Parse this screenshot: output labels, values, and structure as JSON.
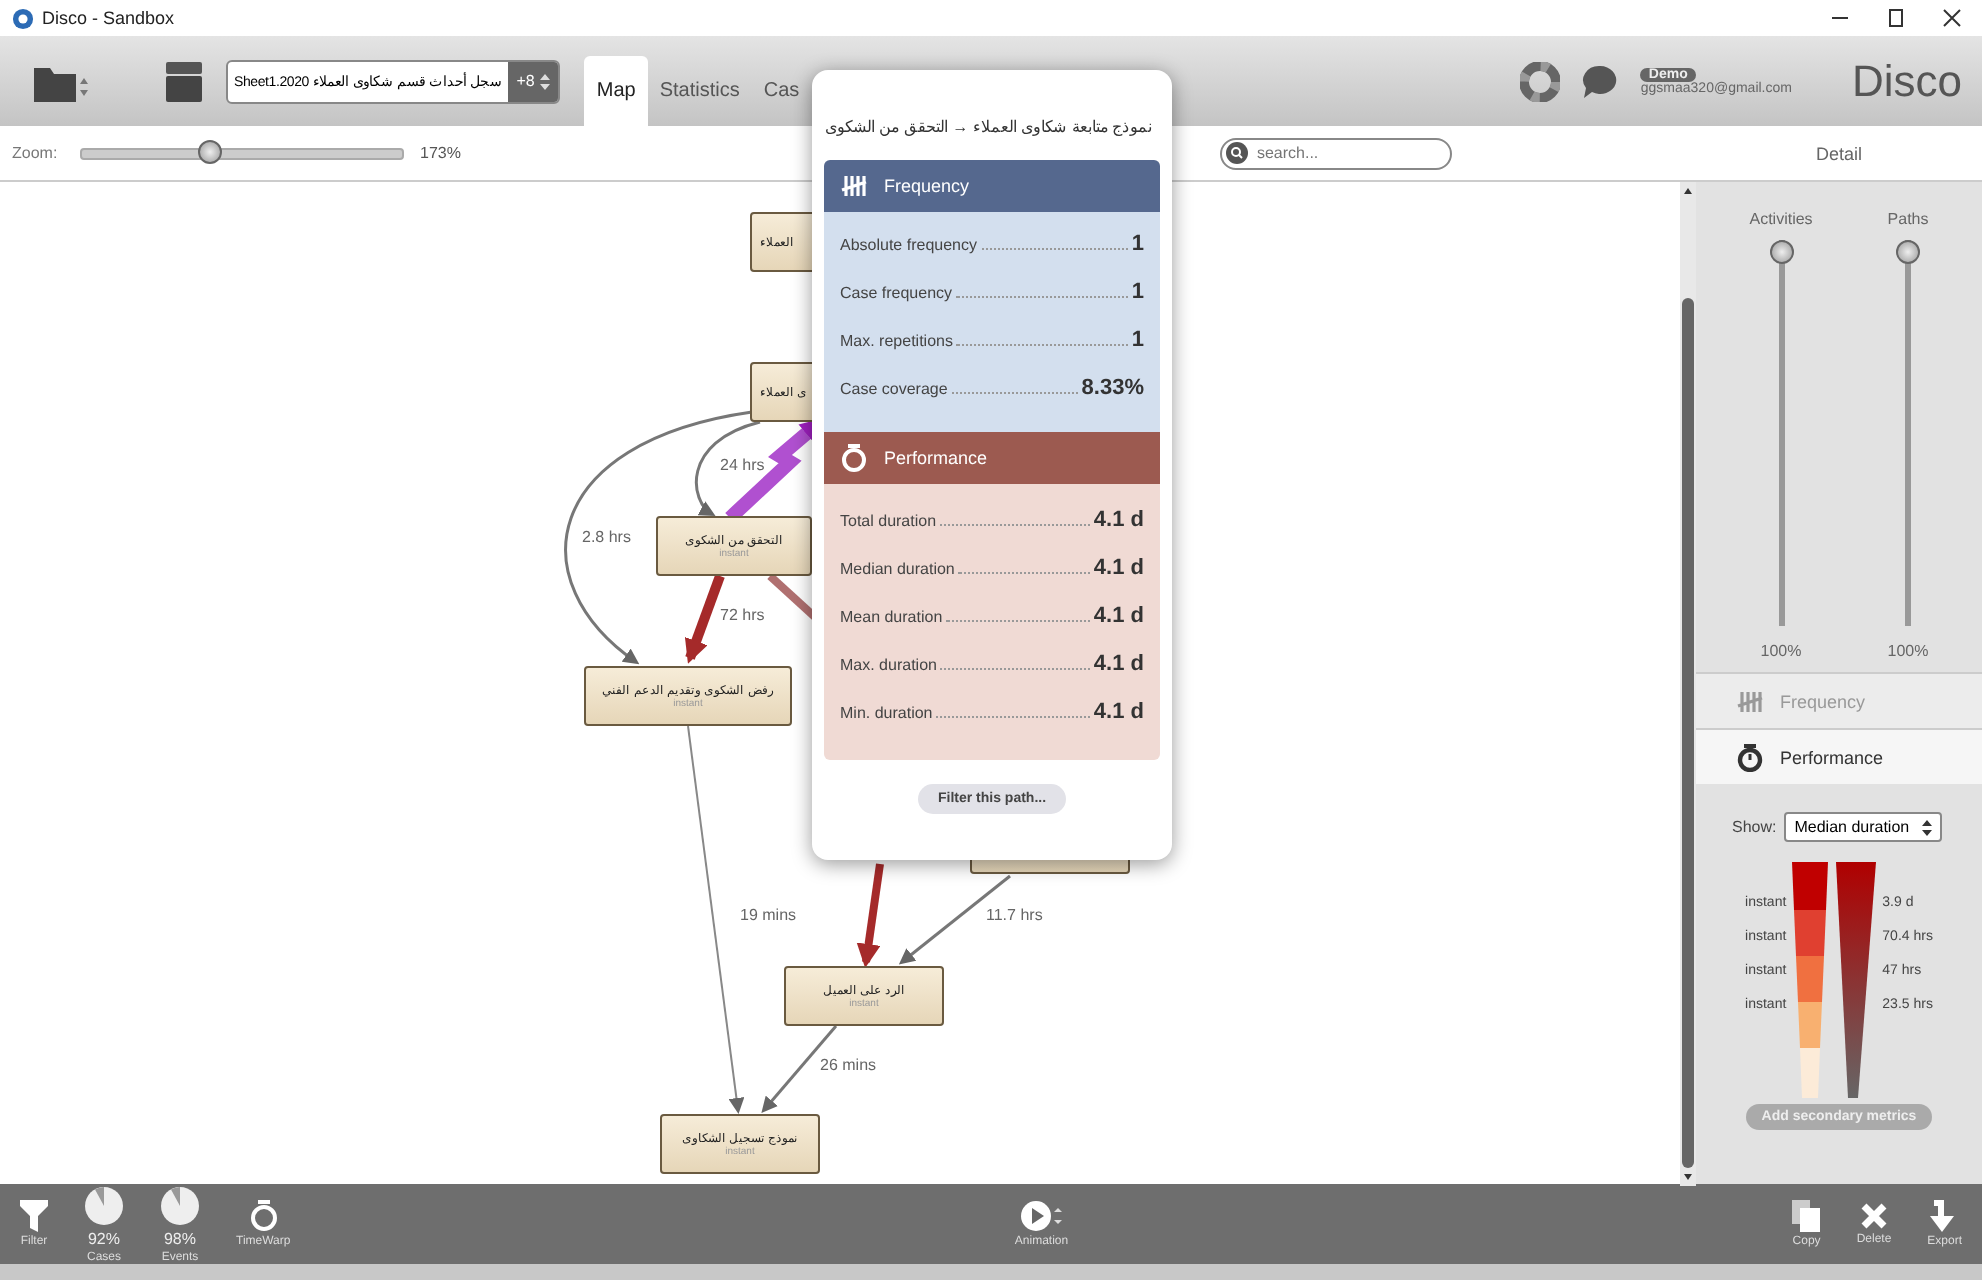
{
  "window": {
    "title": "Disco - Sandbox"
  },
  "toolbar": {
    "dataset": {
      "name": "سجل أحداث قسم شكاوى العملاء Sheet1.2020",
      "count": "+8"
    },
    "tabs": [
      {
        "label": "Map",
        "selected": true
      },
      {
        "label": "Statistics",
        "selected": false
      },
      {
        "label": "Cas",
        "selected": false
      }
    ],
    "user": {
      "badge": "Demo",
      "email": "ggsmaa320@gmail.com"
    },
    "logo": "Disco"
  },
  "zoom": {
    "label": "Zoom:",
    "level": 0.4,
    "reading": "173%"
  },
  "search": {
    "placeholder": "search..."
  },
  "map": {
    "nodes": [
      {
        "label": "العملاء"
      },
      {
        "label": "ى العملاء"
      },
      {
        "label": "التحقق من الشكوى",
        "sublabel": "instant"
      },
      {
        "label": "رفض الشكوى وتقديم الدعم الفني",
        "sublabel": "instant"
      },
      {
        "label": "الرد على العميل",
        "sublabel": "instant"
      },
      {
        "label": "نموذج تسجيل الشكاوى",
        "sublabel": "instant"
      }
    ],
    "edge_labels": [
      "24 hrs",
      "2.8 hrs",
      "72 hrs",
      "19 mins",
      "11.7 hrs",
      "26 mins"
    ]
  },
  "popup": {
    "title": "نموذج متابعة شكاوى العملاء → التحقق من الشكوى",
    "sections": [
      {
        "kind": "frequency",
        "title": "Frequency",
        "rows": [
          {
            "label": "Absolute frequency",
            "value": "1"
          },
          {
            "label": "Case frequency",
            "value": "1"
          },
          {
            "label": "Max. repetitions",
            "value": "1"
          },
          {
            "label": "Case coverage",
            "value": "8.33%"
          }
        ]
      },
      {
        "kind": "performance",
        "title": "Performance",
        "rows": [
          {
            "label": "Total duration",
            "value": "4.1 d"
          },
          {
            "label": "Median duration",
            "value": "4.1 d"
          },
          {
            "label": "Mean duration",
            "value": "4.1 d"
          },
          {
            "label": "Max. duration",
            "value": "4.1 d"
          },
          {
            "label": "Min. duration",
            "value": "4.1 d"
          }
        ]
      }
    ],
    "button": "Filter this path..."
  },
  "detail": {
    "title": "Detail",
    "sliders": [
      {
        "label": "Activities",
        "level": 1,
        "reading": "100%"
      },
      {
        "label": "Paths",
        "level": 1,
        "reading": "100%"
      }
    ],
    "tabs": [
      {
        "kind": "frequency",
        "label": "Frequency",
        "selected": false
      },
      {
        "kind": "performance",
        "label": "Performance",
        "selected": true
      }
    ],
    "show": {
      "label": "Show:",
      "value": "Median duration"
    },
    "legend_left": [
      "instant",
      "instant",
      "instant",
      "instant"
    ],
    "legend_right": [
      "3.9 d",
      "70.4 hrs",
      "47 hrs",
      "23.5 hrs"
    ],
    "button": "Add secondary metrics"
  },
  "bottom_bar": {
    "left": [
      {
        "kind": "filter",
        "label": "Filter"
      },
      {
        "kind": "pie",
        "value": "92%",
        "label": "Cases"
      },
      {
        "kind": "pie",
        "value": "98%",
        "label": "Events"
      },
      {
        "kind": "timewarp",
        "label": "TimeWarp"
      }
    ],
    "center": {
      "kind": "play",
      "label": "Animation"
    },
    "right": [
      {
        "kind": "copy",
        "label": "Copy"
      },
      {
        "kind": "delete",
        "label": "Delete"
      },
      {
        "kind": "export",
        "label": "Export"
      }
    ]
  }
}
